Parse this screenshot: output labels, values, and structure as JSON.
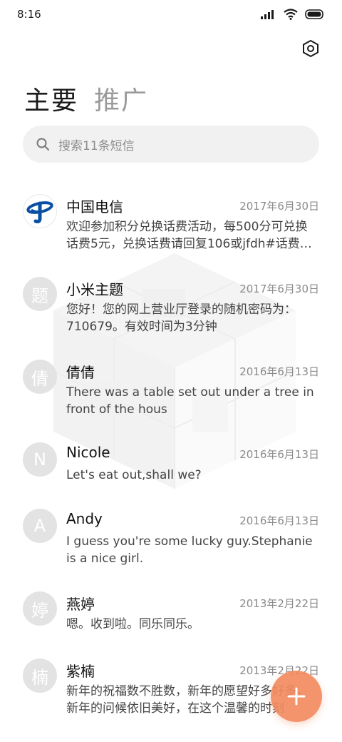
{
  "status_bar": {
    "time": "8:16"
  },
  "tabs": [
    {
      "label": "主要",
      "active": true
    },
    {
      "label": "推广",
      "active": false
    }
  ],
  "search": {
    "placeholder": "搜索11条短信"
  },
  "messages": [
    {
      "avatar": "",
      "avatar_type": "china-telecom-logo",
      "name": "中国电信",
      "date": "2017年6月30日",
      "preview": "欢迎参加积分兑换话费活动，每500分可兑换话费5元，兑换话费请回复106或jfdh#话费…"
    },
    {
      "avatar": "题",
      "name": "小米主题",
      "date": "2017年6月30日",
      "preview": "您好！您的网上营业厅登录的随机密码为：710679。有效时间为3分钟"
    },
    {
      "avatar": "倩",
      "name": "倩倩",
      "date": "2016年6月13日",
      "preview": "There was a table set out under a tree in front of the hous"
    },
    {
      "avatar": "N",
      "name": "Nicole",
      "date": "2016年6月13日",
      "preview": "Let's eat out,shall we?"
    },
    {
      "avatar": "A",
      "name": "Andy",
      "date": "2016年6月13日",
      "preview": "I guess you're some lucky guy.Stephanie is a nice girl."
    },
    {
      "avatar": "婷",
      "name": "燕婷",
      "date": "2013年2月22日",
      "preview": "嗯。收到啦。同乐同乐。"
    },
    {
      "avatar": "楠",
      "name": "紫楠",
      "date": "2013年2月22日",
      "preview": "新年的祝福数不胜数，新年的愿望好多好多，新年的问候依旧美好，在这个温馨的时刻"
    }
  ],
  "colors": {
    "fab": "#f28b60",
    "telecom_blue": "#0a4fa3",
    "avatar_bg": "#e3e3e3"
  },
  "icons": {
    "settings": "settings-hexagon-icon",
    "fab": "plus-icon",
    "search": "search-icon"
  }
}
